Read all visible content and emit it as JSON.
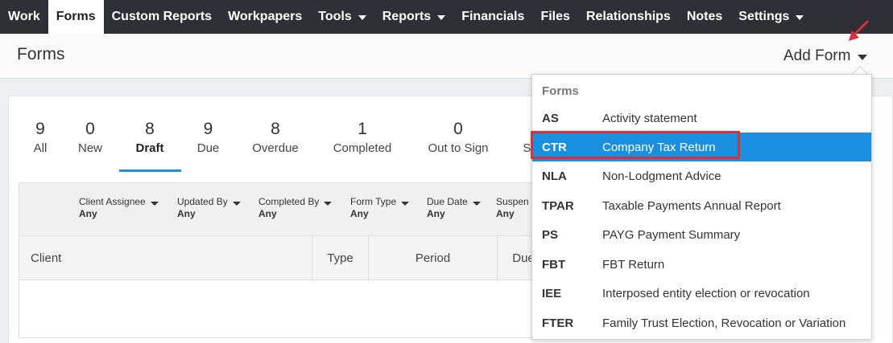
{
  "nav": {
    "items": [
      {
        "label": "Work",
        "caret": false,
        "active": false
      },
      {
        "label": "Forms",
        "caret": false,
        "active": true
      },
      {
        "label": "Custom Reports",
        "caret": false,
        "active": false
      },
      {
        "label": "Workpapers",
        "caret": false,
        "active": false
      },
      {
        "label": "Tools",
        "caret": true,
        "active": false
      },
      {
        "label": "Reports",
        "caret": true,
        "active": false
      },
      {
        "label": "Financials",
        "caret": false,
        "active": false
      },
      {
        "label": "Files",
        "caret": false,
        "active": false
      },
      {
        "label": "Relationships",
        "caret": false,
        "active": false
      },
      {
        "label": "Notes",
        "caret": false,
        "active": false
      },
      {
        "label": "Settings",
        "caret": true,
        "active": false
      }
    ]
  },
  "header": {
    "title": "Forms",
    "add_form_label": "Add Form"
  },
  "stats": [
    {
      "count": "9",
      "label": "All"
    },
    {
      "count": "0",
      "label": "New"
    },
    {
      "count": "8",
      "label": "Draft"
    },
    {
      "count": "9",
      "label": "Due"
    },
    {
      "count": "8",
      "label": "Overdue"
    },
    {
      "count": "1",
      "label": "Completed"
    },
    {
      "count": "0",
      "label": "Out to Sign"
    },
    {
      "count": "",
      "label": "Si"
    }
  ],
  "filters": [
    {
      "label": "Client Assignee",
      "value": "Any"
    },
    {
      "label": "Updated By",
      "value": "Any"
    },
    {
      "label": "Completed By",
      "value": "Any"
    },
    {
      "label": "Form Type",
      "value": "Any"
    },
    {
      "label": "Due Date",
      "value": "Any"
    },
    {
      "label": "Suspen",
      "value": "Any"
    }
  ],
  "table": {
    "columns": [
      "Client",
      "Type",
      "Period",
      "Due"
    ]
  },
  "dropdown": {
    "header": "Forms",
    "items": [
      {
        "code": "AS",
        "name": "Activity statement"
      },
      {
        "code": "CTR",
        "name": "Company Tax Return"
      },
      {
        "code": "NLA",
        "name": "Non-Lodgment Advice"
      },
      {
        "code": "TPAR",
        "name": "Taxable Payments Annual Report"
      },
      {
        "code": "PS",
        "name": "PAYG Payment Summary"
      },
      {
        "code": "FBT",
        "name": "FBT Return"
      },
      {
        "code": "IEE",
        "name": "Interposed entity election or revocation"
      },
      {
        "code": "FTER",
        "name": "Family Trust Election, Revocation or Variation"
      }
    ],
    "highlighted_code": "CTR"
  },
  "colors": {
    "nav_bg": "#2f2f36",
    "accent": "#1a8fe0",
    "annotation_red": "#d6323a"
  }
}
